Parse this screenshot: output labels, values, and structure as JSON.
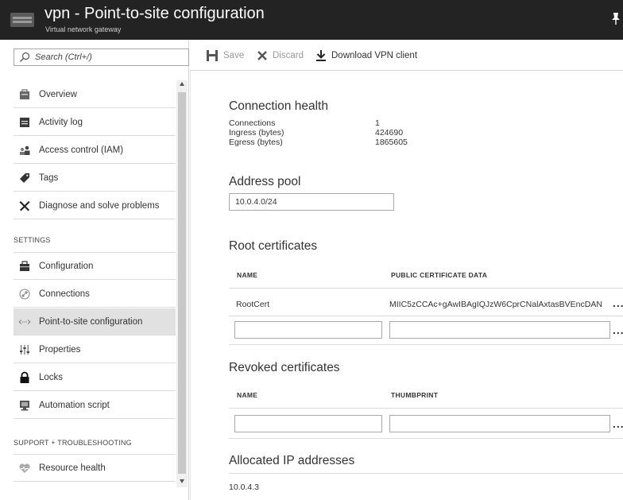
{
  "header": {
    "title": "vpn - Point-to-site configuration",
    "subtitle": "Virtual network gateway",
    "icons": {
      "logo": "vpn-gateway-icon",
      "pin": "pin-icon"
    }
  },
  "sidebar": {
    "search_placeholder": "Search (Ctrl+/)",
    "items": [
      {
        "label": "Overview",
        "icon": "overview-icon"
      },
      {
        "label": "Activity log",
        "icon": "activity-log-icon"
      },
      {
        "label": "Access control (IAM)",
        "icon": "iam-icon"
      },
      {
        "label": "Tags",
        "icon": "tag-icon"
      },
      {
        "label": "Diagnose and solve problems",
        "icon": "wrench-icon"
      }
    ],
    "settings_label": "SETTINGS",
    "settings_items": [
      {
        "label": "Configuration",
        "icon": "configuration-icon"
      },
      {
        "label": "Connections",
        "icon": "connections-icon"
      },
      {
        "label": "Point-to-site configuration",
        "icon": "point-to-site-icon",
        "active": true
      },
      {
        "label": "Properties",
        "icon": "properties-icon"
      },
      {
        "label": "Locks",
        "icon": "lock-icon"
      },
      {
        "label": "Automation script",
        "icon": "automation-icon"
      }
    ],
    "support_label": "SUPPORT + TROUBLESHOOTING",
    "support_items": [
      {
        "label": "Resource health",
        "icon": "heart-icon"
      }
    ]
  },
  "toolbar": {
    "save_label": "Save",
    "discard_label": "Discard",
    "download_label": "Download VPN client"
  },
  "connection_health": {
    "heading": "Connection health",
    "rows": [
      {
        "label": "Connections",
        "value": "1"
      },
      {
        "label": "Ingress (bytes)",
        "value": "424690"
      },
      {
        "label": "Egress (bytes)",
        "value": "1865605"
      }
    ]
  },
  "address_pool": {
    "heading": "Address pool",
    "value": "10.0.4.0/24"
  },
  "root_certificates": {
    "heading": "Root certificates",
    "col_name": "NAME",
    "col_data": "PUBLIC CERTIFICATE DATA",
    "rows": [
      {
        "name": "RootCert",
        "data": "MIIC5zCCAc+gAwIBAgIQJzW6CprCNalAxtasBVEncDAN"
      }
    ],
    "ellipsis": "..."
  },
  "revoked_certificates": {
    "heading": "Revoked certificates",
    "col_name": "NAME",
    "col_thumbprint": "THUMBPRINT",
    "ellipsis": "..."
  },
  "allocated_ips": {
    "heading": "Allocated IP addresses",
    "values": [
      "10.0.4.3"
    ]
  }
}
